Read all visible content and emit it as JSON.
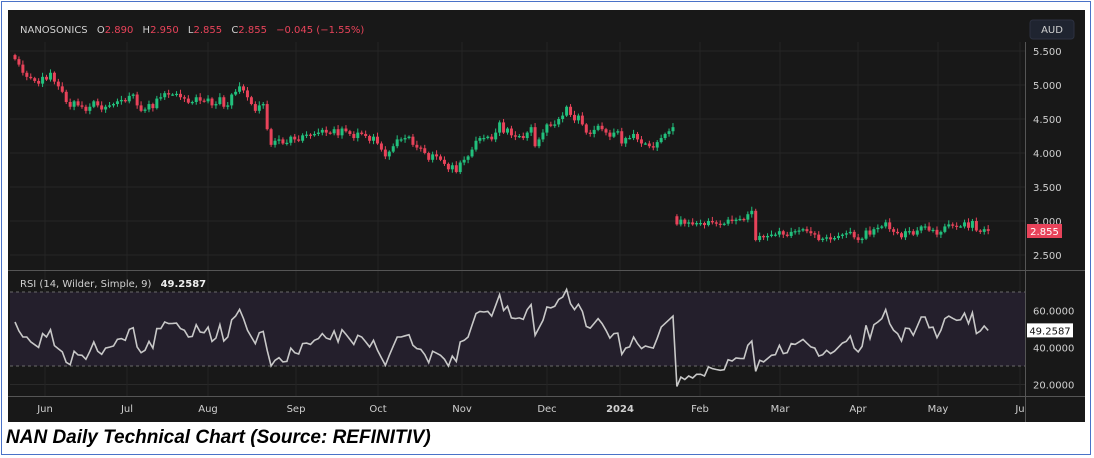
{
  "caption": "NAN Daily Technical Chart (Source: REFINITIV)",
  "colors": {
    "up": "#22c07d",
    "down": "#e8435a",
    "background": "#181818",
    "rsi_line": "#c8c8c8",
    "rsi_band": "#241f2c"
  },
  "legend": {
    "symbol": "NANOSONICS",
    "o_label": "O",
    "o": "2.890",
    "h_label": "H",
    "h": "2.950",
    "l_label": "L",
    "l": "2.855",
    "c_label": "C",
    "c": "2.855",
    "change": "−0.045 (−1.55%)"
  },
  "currency": "AUD",
  "chart_data": [
    {
      "type": "candlestick",
      "title": "NANOSONICS",
      "ylabel": "AUD",
      "ylim": [
        2.3,
        5.6
      ],
      "y_ticks": [
        "5.500",
        "5.000",
        "4.500",
        "4.000",
        "3.500",
        "3.000",
        "2.500"
      ],
      "last_price_label": "2.855",
      "x_ticks": [
        "Jun",
        "Jul",
        "Aug",
        "Sep",
        "Oct",
        "Nov",
        "Dec",
        "2024",
        "Feb",
        "Mar",
        "Apr",
        "May",
        "Ju"
      ],
      "grid": true,
      "closes": [
        5.38,
        5.3,
        5.18,
        5.12,
        5.1,
        5.06,
        5.02,
        5.12,
        5.08,
        5.18,
        5.05,
        4.98,
        4.9,
        4.75,
        4.68,
        4.76,
        4.7,
        4.68,
        4.62,
        4.68,
        4.76,
        4.7,
        4.64,
        4.68,
        4.7,
        4.72,
        4.76,
        4.78,
        4.76,
        4.84,
        4.86,
        4.7,
        4.62,
        4.64,
        4.72,
        4.66,
        4.8,
        4.82,
        4.88,
        4.86,
        4.86,
        4.87,
        4.82,
        4.8,
        4.74,
        4.75,
        4.82,
        4.77,
        4.76,
        4.8,
        4.7,
        4.72,
        4.82,
        4.68,
        4.7,
        4.86,
        4.9,
        4.98,
        4.92,
        4.82,
        4.72,
        4.62,
        4.7,
        4.72,
        4.35,
        4.12,
        4.18,
        4.2,
        4.14,
        4.15,
        4.24,
        4.2,
        4.18,
        4.26,
        4.27,
        4.26,
        4.28,
        4.3,
        4.34,
        4.3,
        4.29,
        4.35,
        4.26,
        4.36,
        4.32,
        4.28,
        4.22,
        4.3,
        4.28,
        4.25,
        4.18,
        4.24,
        4.14,
        4.05,
        3.95,
        4.02,
        4.1,
        4.2,
        4.2,
        4.22,
        4.24,
        4.12,
        4.08,
        4.07,
        4.0,
        3.9,
        3.98,
        3.95,
        3.9,
        3.84,
        3.76,
        3.82,
        3.72,
        3.86,
        3.9,
        3.95,
        4.05,
        4.18,
        4.22,
        4.22,
        4.24,
        4.2,
        4.3,
        4.45,
        4.3,
        4.36,
        4.26,
        4.24,
        4.25,
        4.22,
        4.3,
        4.38,
        4.1,
        4.2,
        4.3,
        4.42,
        4.4,
        4.42,
        4.5,
        4.55,
        4.68,
        4.56,
        4.48,
        4.55,
        4.42,
        4.3,
        4.28,
        4.34,
        4.4,
        4.35,
        4.3,
        4.24,
        4.3,
        4.32,
        4.14,
        4.22,
        4.22,
        4.28,
        4.2,
        4.14,
        4.14,
        4.1,
        4.08,
        4.16,
        4.22,
        4.28,
        4.32,
        4.38,
        2.95,
        3.02,
        2.96,
        2.98,
        2.95,
        2.97,
        2.97,
        2.94,
        3.0,
        2.98,
        2.96,
        2.95,
        2.96,
        3.02,
        3.0,
        3.02,
        3.03,
        3.02,
        3.1,
        3.15,
        2.72,
        2.78,
        2.76,
        2.78,
        2.8,
        2.8,
        2.85,
        2.8,
        2.78,
        2.84,
        2.85,
        2.86,
        2.88,
        2.85,
        2.82,
        2.8,
        2.72,
        2.74,
        2.76,
        2.73,
        2.75,
        2.78,
        2.8,
        2.82,
        2.84,
        2.76,
        2.72,
        2.74,
        2.86,
        2.8,
        2.88,
        2.9,
        2.92,
        2.98,
        2.88,
        2.84,
        2.82,
        2.76,
        2.85,
        2.85,
        2.8,
        2.86,
        2.92,
        2.92,
        2.86,
        2.87,
        2.8,
        2.84,
        2.92,
        2.95,
        2.93,
        2.92,
        2.92,
        2.98,
        2.9,
        3.0,
        2.86,
        2.84,
        2.88,
        2.855
      ]
    },
    {
      "type": "line",
      "title": "RSI (14, Wilder, Simple, 9)",
      "last_value_label": "49.2587",
      "ylim": [
        10,
        78
      ],
      "y_ticks": [
        "60.0000",
        "40.0000",
        "20.0000"
      ],
      "bands": [
        30,
        70
      ],
      "values": [
        53.8,
        49,
        45.7,
        45.7,
        43,
        41.5,
        40,
        47.5,
        45.7,
        49.6,
        41,
        39.3,
        37.6,
        32,
        30.7,
        38,
        36,
        35.8,
        33.6,
        38,
        43,
        38,
        36.3,
        39.7,
        40.2,
        40.8,
        44.4,
        44.8,
        43.9,
        49.8,
        50.7,
        40.3,
        37.2,
        38.5,
        43.3,
        39.7,
        50.2,
        50.2,
        53.8,
        52.9,
        53,
        53.2,
        50.2,
        49.3,
        45.7,
        46,
        52.3,
        48.4,
        48,
        51,
        43.3,
        45.1,
        52.3,
        43.5,
        45.7,
        55,
        57,
        60.6,
        55.6,
        49.3,
        45.7,
        42.1,
        48,
        48.7,
        38.5,
        30,
        33.1,
        34.5,
        32.2,
        32.5,
        39.7,
        37.2,
        36.5,
        42.1,
        42.4,
        41.7,
        43.9,
        44.8,
        47.5,
        45.1,
        44.4,
        48.9,
        43,
        49.6,
        47.1,
        44.4,
        41.7,
        46.6,
        45.7,
        43,
        40.3,
        43.9,
        38.5,
        34.5,
        30.4,
        35.8,
        40.7,
        45.7,
        45.7,
        46.3,
        46.9,
        41.2,
        39.4,
        39,
        36.1,
        31.8,
        38,
        36.9,
        35.8,
        33.6,
        30,
        35.4,
        32.5,
        43,
        43.9,
        45.7,
        52,
        58.3,
        59.5,
        59.2,
        59.5,
        57,
        62.8,
        68.6,
        60,
        62.3,
        56,
        55.6,
        56,
        55.2,
        60.5,
        63.2,
        46.6,
        50.6,
        54.7,
        61.9,
        61.4,
        62.3,
        66,
        67.3,
        71.4,
        63.7,
        60.5,
        63.4,
        59.5,
        51.4,
        50.5,
        53,
        55.6,
        52.9,
        49.3,
        45.1,
        47.5,
        47.8,
        36.3,
        39.7,
        40.3,
        45.7,
        42.1,
        39.4,
        40.8,
        40.2,
        39.7,
        45,
        51,
        53,
        55,
        57,
        19,
        24,
        22.7,
        24.6,
        23.5,
        25.5,
        25.5,
        24.6,
        29.5,
        28.6,
        28.1,
        27.7,
        28,
        33.4,
        32.7,
        34.3,
        34.1,
        34,
        41.2,
        43.5,
        27.1,
        33.1,
        32.2,
        34,
        35.8,
        36.1,
        41.2,
        36.7,
        37.2,
        42.1,
        41.7,
        43,
        44.4,
        42.3,
        40.3,
        39.7,
        35.4,
        36.1,
        38.5,
        36.7,
        38,
        40.2,
        42.4,
        43.3,
        46.2,
        39.7,
        37.6,
        40.6,
        52,
        44.8,
        52.3,
        53.8,
        55.6,
        60.5,
        52.9,
        49.3,
        47.5,
        43.5,
        50.5,
        50.2,
        46.6,
        51.5,
        56.5,
        56.5,
        50.7,
        51,
        45.3,
        49.3,
        55.6,
        57,
        55.8,
        54.7,
        55,
        58.6,
        52.9,
        58.8,
        47.5,
        48.9,
        51.6,
        49.26
      ]
    }
  ]
}
